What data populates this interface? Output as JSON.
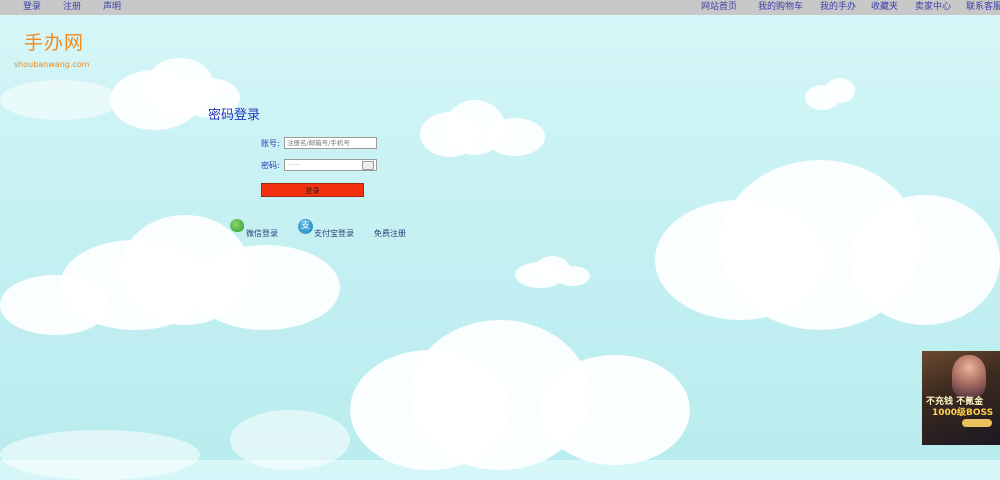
{
  "top_nav": {
    "left": [
      "登录",
      "注册",
      "声明"
    ],
    "right": [
      "网站首页",
      "我的购物车",
      "我的手办",
      "收藏夹",
      "卖家中心",
      "联系客服"
    ]
  },
  "logo": {
    "title": "手办网",
    "subtitle": "shoubanwang.com"
  },
  "login_form": {
    "title": "密码登录",
    "account_label": "账号:",
    "account_placeholder": "注册名/邮箱号/手机号",
    "password_label": "密码:",
    "password_value": "······",
    "submit_label": "登录"
  },
  "alt_login": {
    "wechat": "微信登录",
    "alipay": "支付宝登录",
    "register": "免费注册"
  },
  "ad": {
    "line1": "不充钱 不氪金",
    "line2": "1000级BOSS"
  },
  "colors": {
    "accent_orange": "#f28a1d",
    "title_blue": "#2733b8",
    "submit_red": "#f4300e",
    "nav_bar": "#c8c8c8"
  }
}
